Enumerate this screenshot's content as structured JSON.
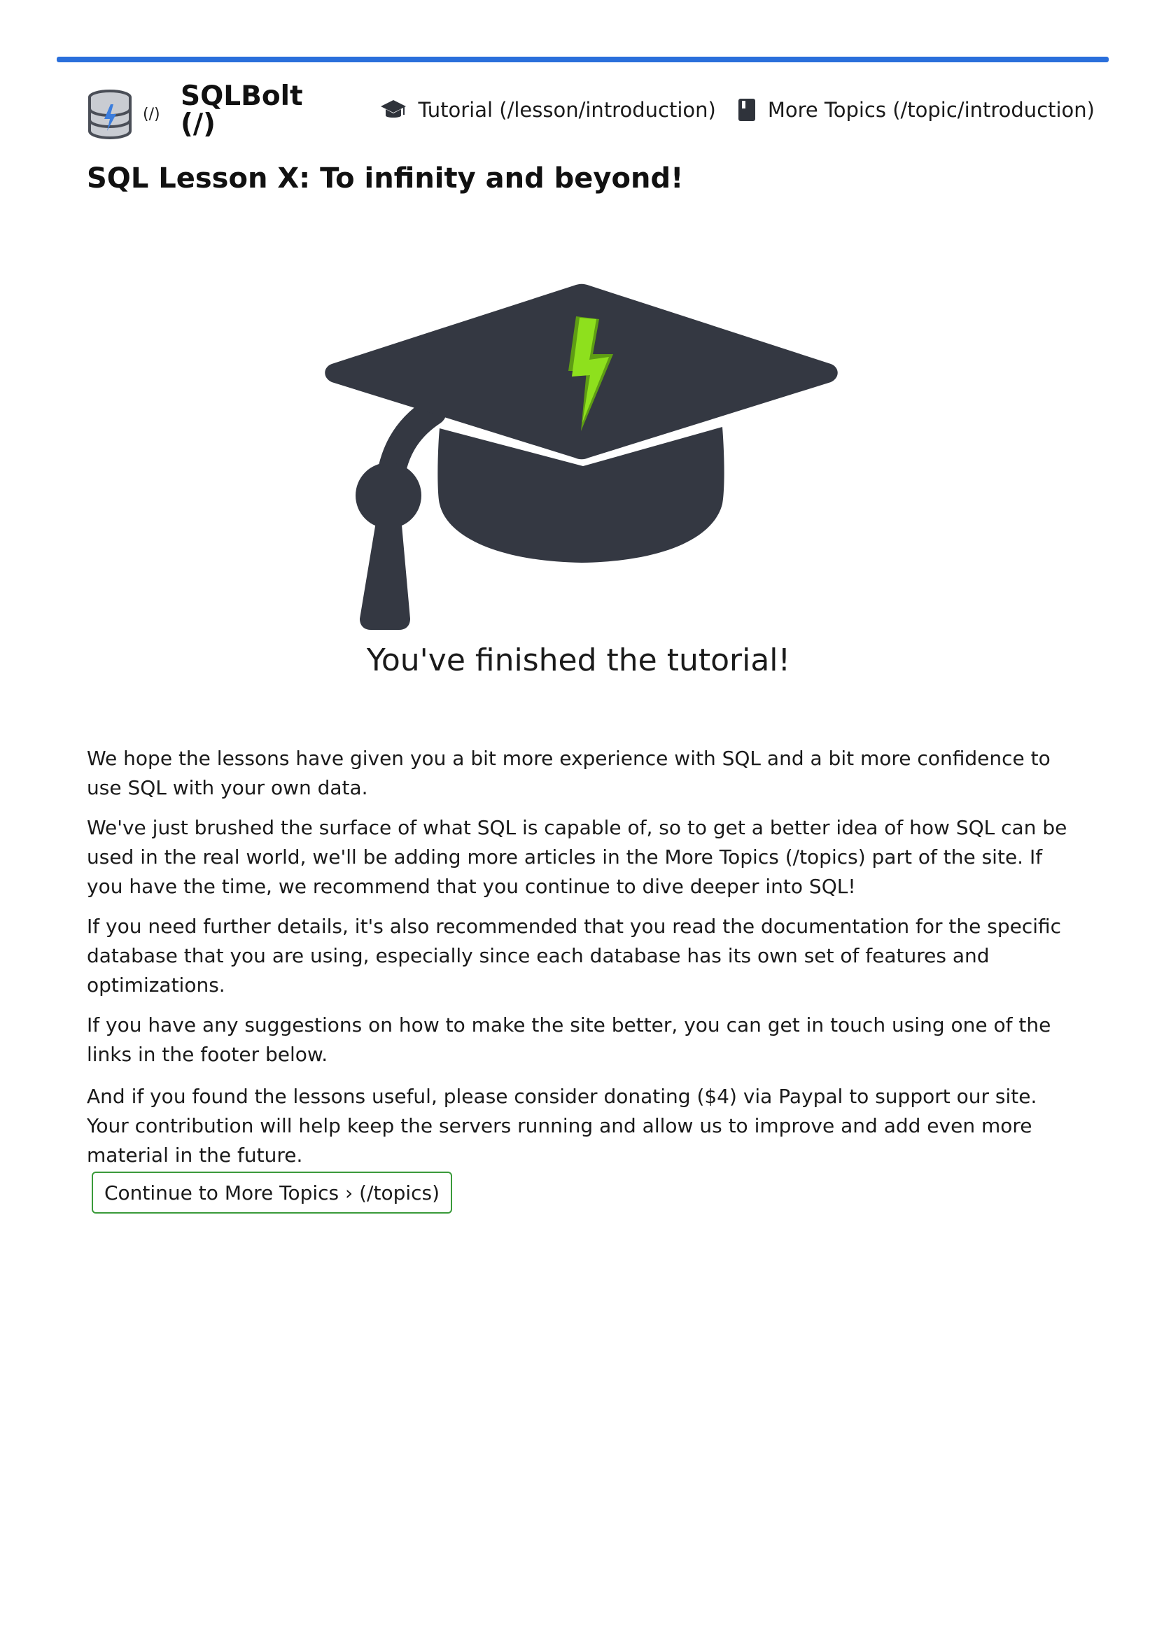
{
  "header": {
    "logo_link_text": "(/)",
    "brand": "SQLBolt (/)",
    "nav": [
      {
        "label": "Tutorial (/lesson/introduction)",
        "icon": "graduation-cap-icon"
      },
      {
        "label": "More Topics (/topic/introduction)",
        "icon": "book-icon"
      }
    ]
  },
  "colors": {
    "accent_bar": "#2a6fdb",
    "cap": "#343842",
    "bolt": "#7fd21b",
    "button_border": "#3a9a3a"
  },
  "page": {
    "title": "SQL Lesson X: To infinity and beyond!",
    "hero_icon": "graduation-cap-bolt-icon",
    "subtitle": "You've finished the tutorial!",
    "paragraphs": [
      "We hope the lessons have given you a bit more experience with SQL and a bit more confidence to use SQL with your own data.",
      "We've just brushed the surface of what SQL is capable of, so to get a better idea of how SQL can be used in the real world, we'll be adding more articles in the More Topics (/topics) part of the site. If you have the time, we recommend that you continue to dive deeper into SQL!",
      "If you need further details, it's also recommended that you read the documentation for the specific database that you are using, especially since each database has its own set of features and optimizations.",
      "If you have any suggestions on how to make the site better, you can get in touch using one of the links in the footer below.",
      "And if you found the lessons useful, please consider donating ($4) via Paypal to support our site. Your contribution will help keep the servers running and allow us to improve and add even more material in the future."
    ],
    "cta_label": "Continue to More Topics › (/topics)"
  }
}
